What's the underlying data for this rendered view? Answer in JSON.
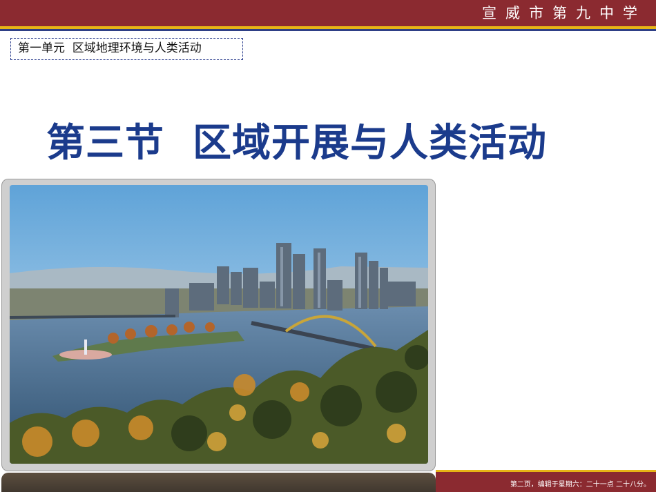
{
  "header": {
    "school_name": "宣威市第九中学"
  },
  "unit_label": "第一单元  区域地理环境与人类活动",
  "title": "第三节  区域开展与人类活动",
  "photo": {
    "subject": "city-river-confluence-photo"
  },
  "footer": {
    "text": "第二页，编辑于星期六：二十一点 二十八分。"
  },
  "colors": {
    "header_red": "#8b2a30",
    "gold": "#e7b416",
    "navy": "#2e3f86",
    "title_blue": "#1b3b8c"
  }
}
